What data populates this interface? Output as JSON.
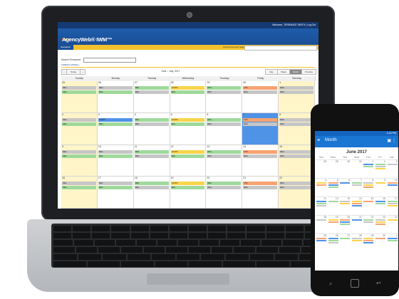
{
  "app": {
    "welcome": "Welcome, TERRANCE SMITH  |  Log Out",
    "logo_text": "AgencyWeb® IWM™",
    "nav_label": "Navigation",
    "quick_search_label": "Quick Personnel Search:",
    "search_label": "Search Personnel:",
    "user_name": "TERESA HOWELL",
    "today_button": "Today",
    "range_title": "June – July, 2017",
    "view_buttons": [
      "Day",
      "Week",
      "Month",
      "Timeline"
    ],
    "weekdays": [
      "Sunday",
      "Monday",
      "Tuesday",
      "Wednesday",
      "Thursday",
      "Friday",
      "Saturday"
    ],
    "weeks": [
      {
        "days": [
          "25",
          "26",
          "27",
          "28",
          "29",
          "30",
          "1"
        ]
      },
      {
        "days": [
          "2",
          "3",
          "4",
          "5",
          "6",
          "7",
          "8"
        ]
      },
      {
        "days": [
          "9",
          "10",
          "11",
          "12",
          "13",
          "14",
          "15"
        ]
      },
      {
        "days": [
          "16",
          "17",
          "18",
          "19",
          "20",
          "21",
          "22"
        ]
      }
    ],
    "event_labels": {
      "reg": "REG",
      "count": "COUNT",
      "court": "COURT",
      "vtr": "VTR"
    },
    "colors": {
      "header_blue": "#1b4f96",
      "accent_yellow": "#f3c12d",
      "event_green": "#9fd99b",
      "event_gray": "#c6c6c6",
      "event_orange": "#f7a372",
      "event_yellow": "#f8d44c",
      "today_blue": "#4f93e6",
      "weekend_yellow": "#fff5c8"
    }
  },
  "phone": {
    "status_time": "4:16 PM",
    "app_title": "Month",
    "month_title": "June 2017",
    "weekdays": [
      "Sun",
      "Mon",
      "Tue",
      "Wed",
      "Thu",
      "Fri",
      "Sat"
    ],
    "dates": [
      "28",
      "29",
      "30",
      "31",
      "1",
      "2",
      "3",
      "4",
      "5",
      "6",
      "7",
      "8",
      "9",
      "10",
      "11",
      "12",
      "13",
      "14",
      "15",
      "16",
      "17",
      "18",
      "19",
      "20",
      "21",
      "22",
      "23",
      "24",
      "25",
      "26",
      "27",
      "28",
      "29",
      "30",
      "1"
    ]
  }
}
